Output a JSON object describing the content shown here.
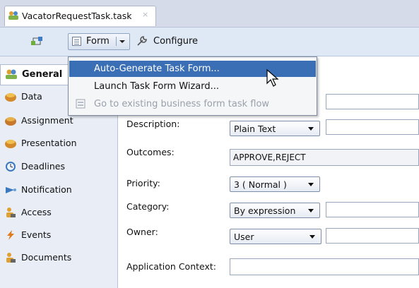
{
  "tab": {
    "title": "VacatorRequestTask.task",
    "close": "×"
  },
  "toolbar": {
    "form_label": "Form",
    "configure_label": "Configure"
  },
  "menu": {
    "items": [
      {
        "label": "Auto-Generate Task Form..."
      },
      {
        "label": "Launch Task Form Wizard..."
      },
      {
        "label": "Go to existing business form task flow"
      }
    ]
  },
  "nav": {
    "items": [
      {
        "label": "General"
      },
      {
        "label": "Data"
      },
      {
        "label": "Assignment"
      },
      {
        "label": "Presentation"
      },
      {
        "label": "Deadlines"
      },
      {
        "label": "Notification"
      },
      {
        "label": "Access"
      },
      {
        "label": "Events"
      },
      {
        "label": "Documents"
      }
    ]
  },
  "form": {
    "description_label": "Description:",
    "description_value": "Plain Text",
    "outcomes_label": "Outcomes:",
    "outcomes_value": "APPROVE,REJECT",
    "priority_label": "Priority:",
    "priority_value": "3  ( Normal )",
    "category_label": "Category:",
    "category_value": "By expression",
    "owner_label": "Owner:",
    "owner_value": "User",
    "appctx_label": "Application Context:"
  },
  "colors": {
    "selection": "#3b6fb5",
    "toolbar": "#dfe8f5",
    "nav_bg": "#e9eef6"
  }
}
